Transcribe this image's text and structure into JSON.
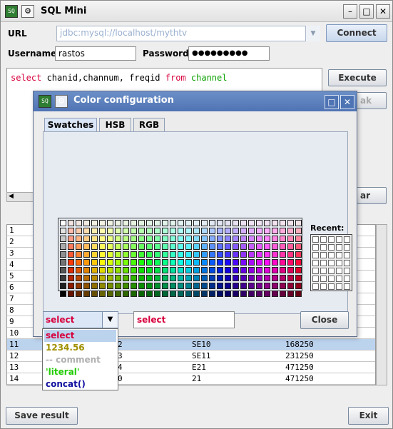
{
  "window": {
    "title": "SQL Mini",
    "url_label": "URL",
    "url_value": "jdbc:mysql://localhost/mythtv",
    "connect_label": "Connect",
    "username_label": "Username",
    "username_value": "rastos",
    "password_label": "Password",
    "password_value": "●●●●●●●●●",
    "execute_label": "Execute",
    "break_label": "ak",
    "clear_label": "ar",
    "save_label": "Save result",
    "exit_label": "Exit"
  },
  "query": {
    "kw_select": "select",
    "columns": " chanid,channum, freqid ",
    "kw_from": "from",
    "space": " ",
    "table": "channel"
  },
  "table_rows": [
    {
      "n": "1",
      "c2": "",
      "c3": "",
      "c4": ""
    },
    {
      "n": "2",
      "c2": "",
      "c3": "",
      "c4": ""
    },
    {
      "n": "3",
      "c2": "",
      "c3": "",
      "c4": ""
    },
    {
      "n": "4",
      "c2": "",
      "c3": "",
      "c4": ""
    },
    {
      "n": "5",
      "c2": "",
      "c3": "",
      "c4": ""
    },
    {
      "n": "6",
      "c2": "",
      "c3": "",
      "c4": ""
    },
    {
      "n": "7",
      "c2": "",
      "c3": "",
      "c4": ""
    },
    {
      "n": "8",
      "c2": "",
      "c3": "",
      "c4": ""
    },
    {
      "n": "9",
      "c2": "",
      "c3": "",
      "c4": ""
    },
    {
      "n": "10",
      "c2": "",
      "c3": "",
      "c4": ""
    },
    {
      "n": "11",
      "c2": "2",
      "c3": "SE10",
      "c4": "168250"
    },
    {
      "n": "12",
      "c2": "3",
      "c3": "SE11",
      "c4": "231250"
    },
    {
      "n": "13",
      "c2": "4",
      "c3": "E21",
      "c4": "471250"
    },
    {
      "n": "14",
      "c2": "0",
      "c3": "21",
      "c4": "471250"
    }
  ],
  "dialog": {
    "title": "Color configuration",
    "tabs": [
      "Swatches",
      "HSB",
      "RGB"
    ],
    "recent_label": "Recent:",
    "dropdown_value": "select",
    "preview_text": "select",
    "close_label": "Close",
    "options": [
      {
        "label": "select",
        "color": "#d8003c"
      },
      {
        "label": "1234.56",
        "color": "#a09000"
      },
      {
        "label": "-- comment",
        "color": "#b0b0b0"
      },
      {
        "label": "'literal'",
        "color": "#22cc00"
      },
      {
        "label": "concat()",
        "color": "#1010a0"
      }
    ]
  },
  "colors": {
    "keyword": "#d8003c",
    "table_name": "#0aa000",
    "selection": "#bcd3ee",
    "dialog_title": "#4f74b4"
  }
}
